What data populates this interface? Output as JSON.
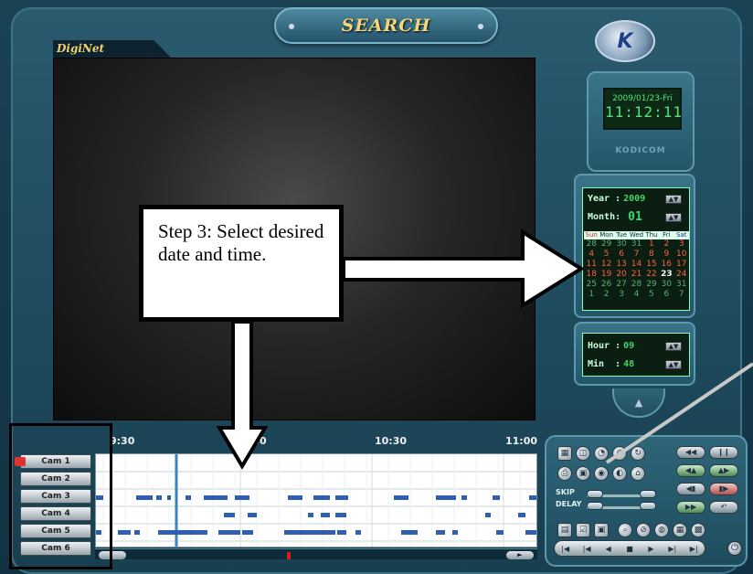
{
  "window": {
    "title": "SEARCH",
    "brand": "DigiNet",
    "logo_letter": "K"
  },
  "clock": {
    "date": "2009/01/23-Fri",
    "time": "11:12:11",
    "brand": "KODICOM"
  },
  "calendar": {
    "year_label": "Year :",
    "year_value": "2009",
    "month_label": "Month:",
    "month_value": "01",
    "weekdays": [
      "Sun",
      "Mon",
      "Tue",
      "Wed",
      "Thu",
      "Fri",
      "Sat"
    ],
    "weeks": [
      [
        "28",
        "29",
        "30",
        "31",
        "1",
        "2",
        "3"
      ],
      [
        "4",
        "5",
        "6",
        "7",
        "8",
        "9",
        "10"
      ],
      [
        "11",
        "12",
        "13",
        "14",
        "15",
        "16",
        "17"
      ],
      [
        "18",
        "19",
        "20",
        "21",
        "22",
        "23",
        "24"
      ],
      [
        "25",
        "26",
        "27",
        "28",
        "29",
        "30",
        "31"
      ],
      [
        "1",
        "2",
        "3",
        "4",
        "5",
        "6",
        "7"
      ]
    ],
    "selected_day": "23"
  },
  "time_select": {
    "hour_label": "Hour :",
    "hour_value": "09",
    "min_label": "Min  :",
    "min_value": "48"
  },
  "timeline": {
    "labels": [
      {
        "text": "9:30"
      },
      {
        "text": ":00"
      },
      {
        "text": "10:30"
      },
      {
        "text": "11:00"
      }
    ],
    "cameras": [
      "Cam 1",
      "Cam 2",
      "Cam 3",
      "Cam 4",
      "Cam 5",
      "Cam 6"
    ]
  },
  "controls": {
    "skip_label": "SKIP",
    "delay_label": "DELAY"
  },
  "annotation": {
    "callout_text": "Step 3: Select desired date and time."
  },
  "colors": {
    "panel": "#24566a",
    "accent": "#43d46a",
    "record_bar": "#2f5fb0"
  }
}
